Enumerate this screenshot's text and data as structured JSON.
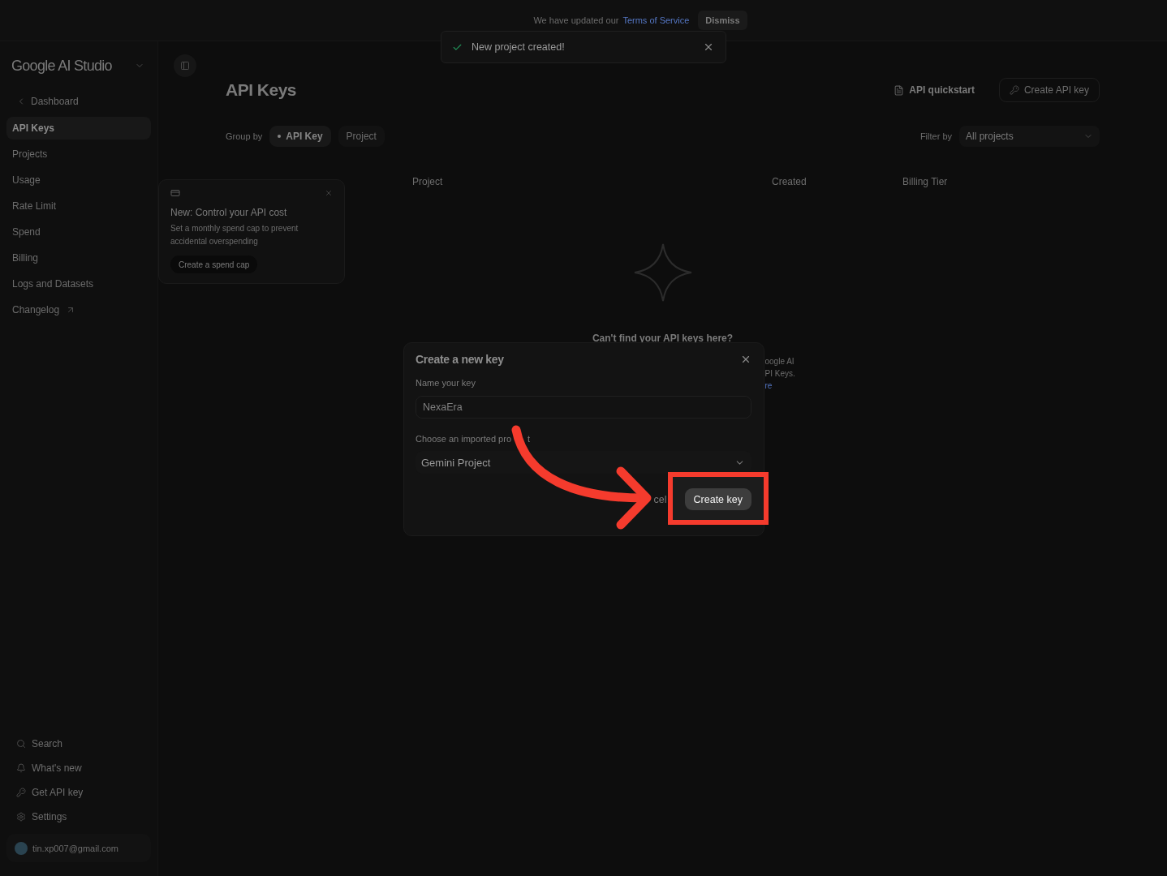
{
  "banner": {
    "text": "We have updated our",
    "link": "Terms of Service",
    "button": "Dismiss"
  },
  "toast": {
    "message": "New project created!"
  },
  "sidebar": {
    "brand": "Google AI Studio",
    "back_link": "Dashboard",
    "items": [
      {
        "label": "API Keys",
        "selected": true,
        "external": false
      },
      {
        "label": "Projects",
        "selected": false,
        "external": false
      },
      {
        "label": "Usage",
        "selected": false,
        "external": false
      },
      {
        "label": "Rate Limit",
        "selected": false,
        "external": false
      },
      {
        "label": "Spend",
        "selected": false,
        "external": false
      },
      {
        "label": "Billing",
        "selected": false,
        "external": false
      },
      {
        "label": "Logs and Datasets",
        "selected": false,
        "external": false
      },
      {
        "label": "Changelog",
        "selected": false,
        "external": true
      }
    ],
    "footer_items": [
      {
        "label": "Search",
        "kind": "search"
      },
      {
        "label": "What's new",
        "kind": "news"
      },
      {
        "label": "Get API key",
        "kind": "key"
      },
      {
        "label": "Settings",
        "kind": "settings"
      }
    ],
    "account": {
      "email": "tin.xp007@gmail.com"
    }
  },
  "header": {
    "title": "API Keys",
    "quickstart": "API quickstart",
    "create_button": "Create API key"
  },
  "group_by": {
    "label": "Group by",
    "options": [
      {
        "label": "API Key",
        "selected": true
      },
      {
        "label": "Project",
        "selected": false
      }
    ]
  },
  "filter": {
    "label": "Filter by",
    "value": "All projects"
  },
  "promo": {
    "title": "New: Control your API cost",
    "description": "Set a monthly spend cap to prevent accidental overspending",
    "button": "Create a spend cap"
  },
  "table": {
    "columns": [
      "Project",
      "Created",
      "Billing Tier"
    ]
  },
  "empty_state": {
    "heading": "Can't find your API keys here?",
    "fragments": [
      "oogle AI",
      "PI Keys."
    ],
    "link": "re"
  },
  "dialog": {
    "title": "Create a new key",
    "name_label": "Name your key",
    "name_value": "NexaEra",
    "project_label": "Choose an imported pro",
    "project_label_tail": "t",
    "project_value": "Gemini Project",
    "cancel": "cel",
    "submit": "Create key"
  }
}
